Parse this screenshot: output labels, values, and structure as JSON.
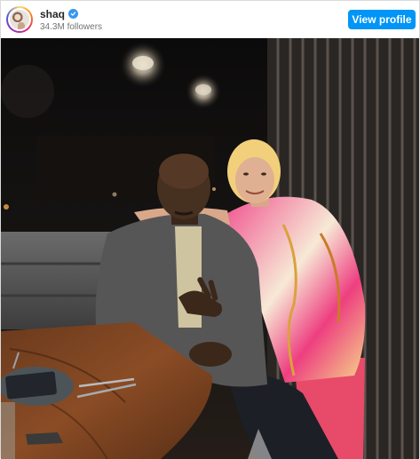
{
  "header": {
    "username": "shaq",
    "followers": "34.3M followers",
    "view_profile_label": "View profile"
  },
  "icons": {
    "verified": "verified-badge-icon"
  },
  "colors": {
    "button": "#0095f6",
    "verified": "#3897f0"
  }
}
